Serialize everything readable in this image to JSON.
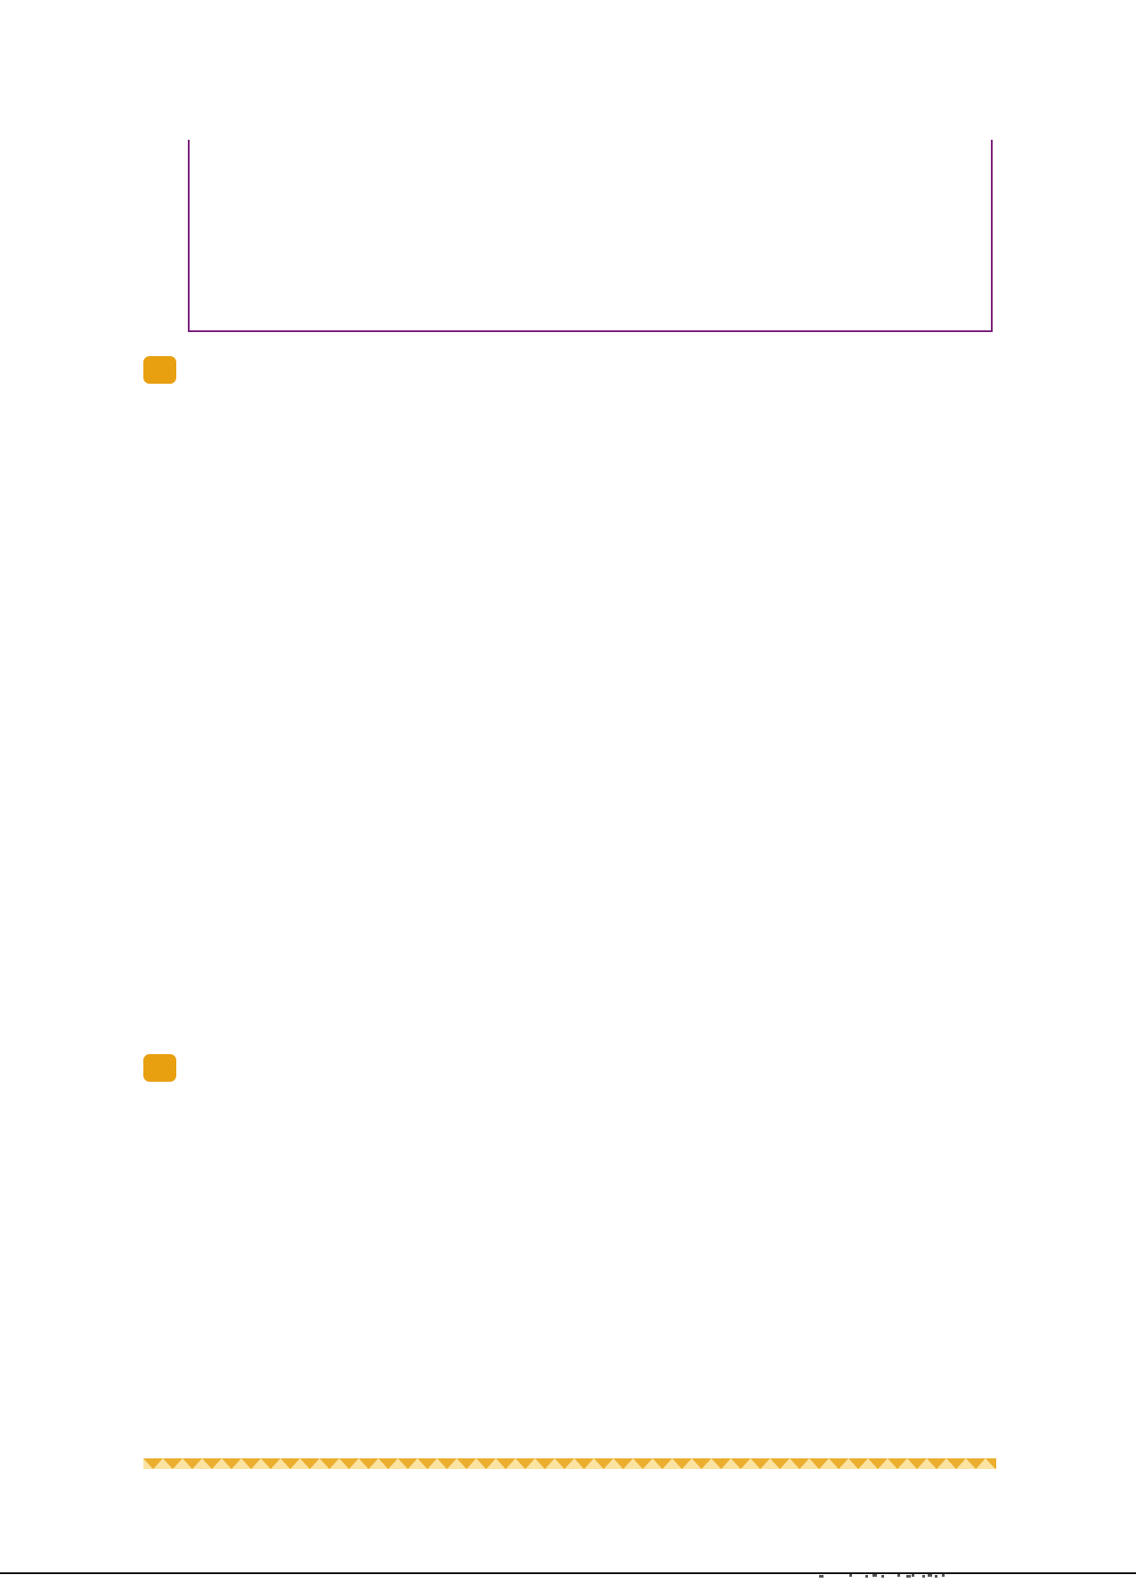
{
  "colors": {
    "frame_border": "#7a1f7a",
    "marker_fill": "#e89f10",
    "band_dark": "#ecae2e",
    "band_light": "#fbe3a2",
    "rule": "#111111"
  },
  "icons": {
    "section_marker": "rounded-square-badge"
  }
}
